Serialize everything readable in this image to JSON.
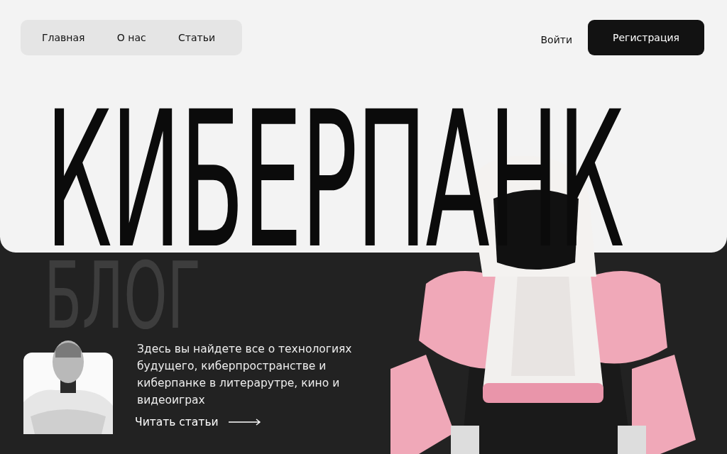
{
  "nav": {
    "items": [
      {
        "label": "Главная"
      },
      {
        "label": "О нас"
      },
      {
        "label": "Статьи"
      }
    ]
  },
  "auth": {
    "login": "Войти",
    "register": "Регистрация"
  },
  "hero": {
    "title": "КИБЕРПАНК",
    "subtitle": "БЛОГ"
  },
  "intro": {
    "text": "Здесь вы найдете все о технологиях будущего, киберпространстве и киберпанке в литерарутре, кино и видеоиграх",
    "link": "Читать статьи"
  }
}
